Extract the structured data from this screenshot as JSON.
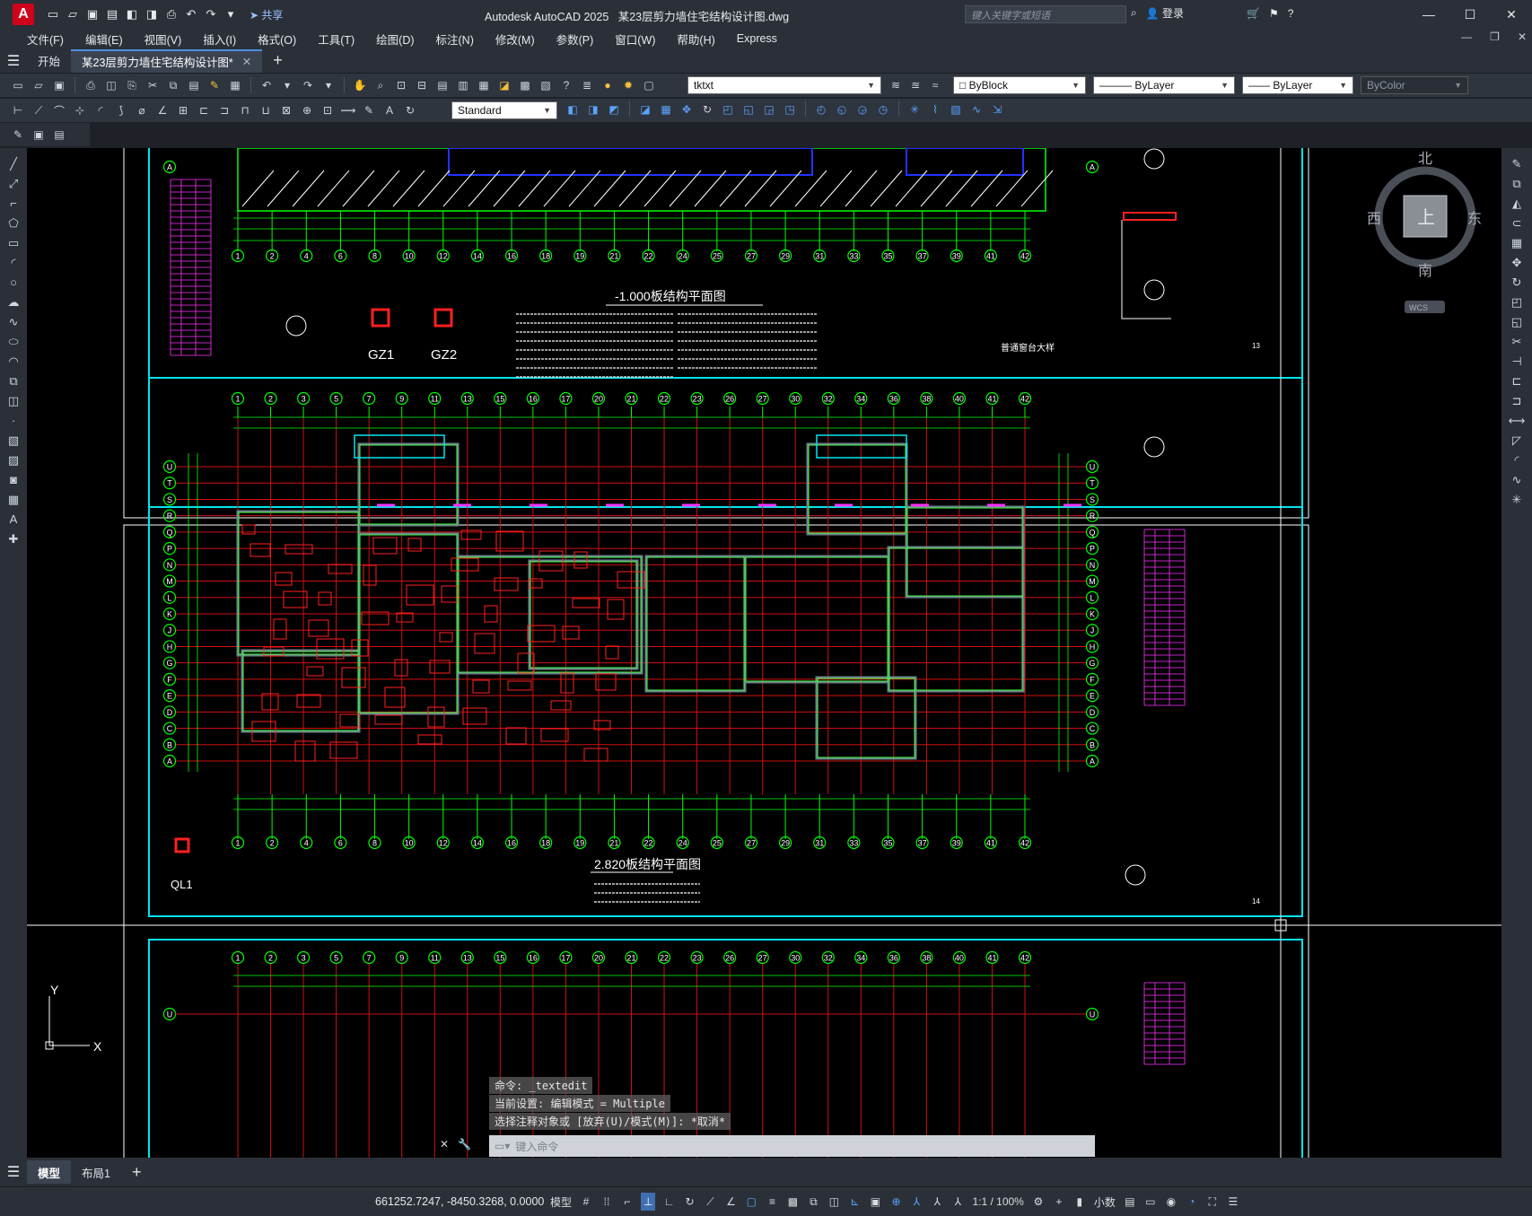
{
  "title_bar": {
    "app_title": "Autodesk AutoCAD 2025",
    "file_name": "某23层剪力墙住宅结构设计图.dwg",
    "share_label": "共享",
    "search_placeholder": "键入关键字或短语",
    "login_label": "登录"
  },
  "menu": {
    "items": [
      "文件(F)",
      "编辑(E)",
      "视图(V)",
      "插入(I)",
      "格式(O)",
      "工具(T)",
      "绘图(D)",
      "标注(N)",
      "修改(M)",
      "参数(P)",
      "窗口(W)",
      "帮助(H)",
      "Express"
    ]
  },
  "tabs": {
    "start": "开始",
    "document": "某23层剪力墙住宅结构设计图*"
  },
  "toolbar": {
    "text_layer": "tktxt",
    "color": "ByBlock",
    "linetype": "ByLayer",
    "lineweight": "ByLayer",
    "plot_style": "ByColor",
    "dim_style": "Standard"
  },
  "viewcube": {
    "north": "北",
    "south": "南",
    "east": "东",
    "west": "西",
    "face": "上",
    "wcs": "WCS"
  },
  "drawing": {
    "plan1_title": "-1.000板结构平面图",
    "plan2_title": "2.820板结构平面图",
    "detail_gz1": "GZ1",
    "detail_gz2": "GZ2",
    "detail_ql1": "QL1",
    "detail_window": "普通窗台大样",
    "sheet13": "13",
    "sheet14": "14",
    "grid_numbers_top": [
      "1",
      "2",
      "3",
      "5",
      "7",
      "9",
      "11",
      "13",
      "15",
      "16",
      "17",
      "20",
      "21",
      "22",
      "23",
      "26",
      "27",
      "30",
      "32",
      "34",
      "36",
      "38",
      "40",
      "41",
      "42"
    ],
    "grid_numbers_bottom": [
      "1",
      "2",
      "4",
      "6",
      "8",
      "10",
      "12",
      "14",
      "16",
      "18",
      "19",
      "21",
      "22",
      "24",
      "25",
      "27",
      "29",
      "31",
      "33",
      "35",
      "37",
      "39",
      "41",
      "42"
    ],
    "grid_letters": [
      "U",
      "T",
      "S",
      "R",
      "Q",
      "P",
      "N",
      "M",
      "L",
      "K",
      "J",
      "H",
      "G",
      "F",
      "E",
      "D",
      "C",
      "B",
      "A"
    ]
  },
  "command": {
    "line1": "命令: _textedit",
    "line2": "当前设置: 编辑模式 = Multiple",
    "line3": "选择注释对象或 [放弃(U)/模式(M)]: *取消*",
    "placeholder": "键入命令"
  },
  "layout_tabs": {
    "model": "模型",
    "layout1": "布局1"
  },
  "status": {
    "coordinates": "661252.7247, -8450.3268, 0.0000",
    "model": "模型",
    "scale": "1:1 / 100%",
    "units": "小数"
  }
}
